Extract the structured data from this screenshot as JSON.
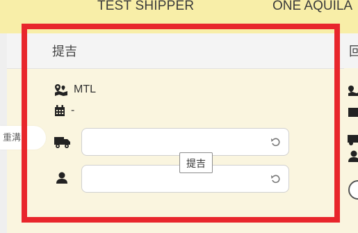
{
  "top_bar": {
    "shipper_label": "TEST SHIPPER",
    "vessel_label": "ONE AQUILA"
  },
  "card": {
    "header_label": "提吉",
    "location_value": "MTL",
    "date_value": "-",
    "truck_input": {
      "value": "",
      "placeholder": ""
    },
    "driver_input": {
      "value": "",
      "placeholder": ""
    },
    "tooltip_text": "提吉"
  },
  "right_column": {
    "header_label": "回"
  },
  "left_tab": {
    "label": "重溝"
  },
  "colors": {
    "highlight": "#e8262c",
    "top_bar": "#f8eea8",
    "card_bg": "#faf5df"
  },
  "icons": {
    "location": "map-marker-icon",
    "date": "calendar-icon",
    "truck": "truck-icon",
    "driver": "user-icon",
    "reset": "undo-icon"
  }
}
